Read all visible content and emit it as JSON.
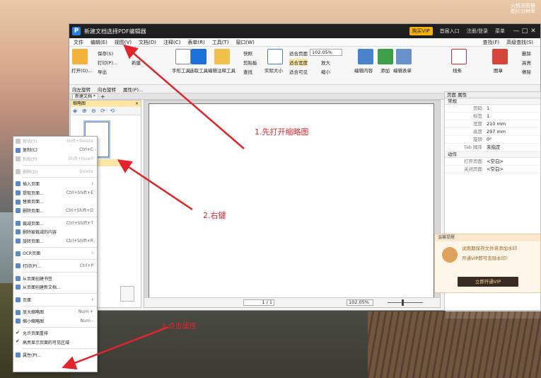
{
  "tray": {
    "line1": "火帆浏览器",
    "line2": "图片分辨率"
  },
  "window": {
    "title": "新建文档选择PDF编辑器",
    "vip_label": "购买VIP",
    "links": [
      "首届入口",
      "注册/登录",
      "菜单"
    ],
    "controls": [
      "—",
      "□",
      "✕"
    ]
  },
  "menubar": {
    "items": [
      "文件",
      "编辑(E)",
      "视图(V)",
      "文档(D)",
      "注释(C)",
      "表单(R)",
      "工具(T)",
      "窗口(W)"
    ],
    "right": [
      "查找(F)",
      "高级查找(S)"
    ]
  },
  "ribbon": {
    "open": "打开(O)...",
    "save": "保存(S)",
    "print": "打印(P)...",
    "new": "新建",
    "export": "导出",
    "hand": "手形工具",
    "select": "选取工具",
    "annotate_select": "编辑注释工具",
    "snapshot": "快照",
    "clipboard": "剪贴板",
    "find": "查找",
    "actual_size": "实际大小",
    "fit_page": "适合页面",
    "fit_width": "适合宽度",
    "fit_visible": "适合可见",
    "zoom": "102.05%",
    "zoom_in": "放大",
    "zoom_out": "缩小",
    "edit_content": "编辑内容",
    "add": "添加",
    "edit_form": "编辑表单",
    "line": "线条",
    "stamp": "图章",
    "right_items": [
      "删除",
      "高亮",
      "擦除"
    ]
  },
  "subbar": {
    "items": [
      "向左旋转",
      "向右旋转",
      "属性(P)..."
    ]
  },
  "tabs": {
    "doc": "新建文档 *",
    "add": "+"
  },
  "thumbnails": {
    "header": "缩略图",
    "close": "×",
    "tools": "◈ ⊕ ⊖ ⟳ ⟲"
  },
  "doc_status": {
    "page": "1 / 1",
    "zoom": "102.05%"
  },
  "properties": {
    "header": "页面 属性",
    "section_general": "常规",
    "rows": [
      {
        "k": "页码",
        "v": "1"
      },
      {
        "k": "标签",
        "v": "1"
      },
      {
        "k": "宽度",
        "v": "210 mm"
      },
      {
        "k": "高度",
        "v": "297 mm"
      },
      {
        "k": "旋转",
        "v": "0°"
      },
      {
        "k": "Tab 顺序",
        "v": "未指定"
      }
    ],
    "section_actions": "动作",
    "action_rows": [
      {
        "k": "打开页面",
        "v": "<空白>"
      },
      {
        "k": "关闭页面",
        "v": "<空白>"
      }
    ]
  },
  "vip_popup": {
    "title": "温馨提醒",
    "line1": "试用期保存文件将添加水印",
    "line2": "开通VIP即可去除水印！",
    "button": "立即开通VIP"
  },
  "context_menu": {
    "items": [
      {
        "label": "剪切(T)",
        "shortcut": "Shift+Delete",
        "disabled": true
      },
      {
        "label": "复制(C)",
        "shortcut": "Ctrl+C",
        "disabled": false
      },
      {
        "label": "粘贴(P)",
        "shortcut": "Shift+Insert",
        "disabled": true
      },
      {
        "sep": true
      },
      {
        "label": "删除(D)",
        "shortcut": "Delete",
        "disabled": true
      },
      {
        "sep": true
      },
      {
        "label": "插入页面",
        "shortcut": "",
        "sub": "›",
        "disabled": false
      },
      {
        "label": "提取页面...",
        "shortcut": "Ctrl+Shift+E",
        "disabled": false
      },
      {
        "label": "替换页面...",
        "shortcut": "",
        "disabled": false
      },
      {
        "label": "删除页面...",
        "shortcut": "Ctrl+Shift+D",
        "disabled": false
      },
      {
        "sep": true
      },
      {
        "label": "裁减页面...",
        "shortcut": "Ctrl+Shift+T",
        "disabled": false
      },
      {
        "label": "删除被裁减的内容",
        "shortcut": "",
        "disabled": false
      },
      {
        "label": "旋转页面...",
        "shortcut": "Ctrl+Shift+R",
        "disabled": false
      },
      {
        "sep": true
      },
      {
        "label": "OCR页面",
        "shortcut": "",
        "sub": "›",
        "disabled": false
      },
      {
        "sep": true
      },
      {
        "label": "打印(P)...",
        "shortcut": "Ctrl+P",
        "disabled": false
      },
      {
        "sep": true
      },
      {
        "label": "从页面创建书签",
        "shortcut": "",
        "disabled": false
      },
      {
        "label": "从页面创建新文档...",
        "shortcut": "",
        "disabled": false
      },
      {
        "sep": true
      },
      {
        "label": "页面",
        "shortcut": "",
        "sub": "›",
        "disabled": false
      },
      {
        "sep": true
      },
      {
        "label": "放大缩略图",
        "shortcut": "Num +",
        "disabled": false
      },
      {
        "label": "缩小缩略图",
        "shortcut": "Num -",
        "disabled": false
      },
      {
        "sep": true
      },
      {
        "label": "允许页面重排",
        "shortcut": "",
        "check": true,
        "disabled": false
      },
      {
        "label": "高亮显示页面的可见区域",
        "shortcut": "",
        "check": true,
        "disabled": false
      },
      {
        "sep": true
      },
      {
        "label": "属性(P)...",
        "shortcut": "",
        "disabled": false
      }
    ]
  },
  "annotations": {
    "step1": "1.先打开缩略图",
    "step2": "2.右键",
    "step3": "3.点击属性",
    "color": "#e3242b"
  }
}
